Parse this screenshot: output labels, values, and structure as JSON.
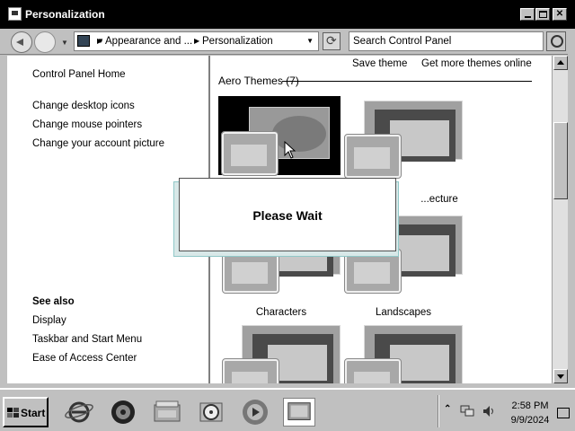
{
  "window": {
    "title": "Personalization"
  },
  "address": {
    "crumbs": [
      "Appearance and ...",
      "Personalization"
    ],
    "search_placeholder": "Search Control Panel"
  },
  "left_pane": {
    "links": [
      "Control Panel Home",
      "Change desktop icons",
      "Change mouse pointers",
      "Change your account picture"
    ],
    "see_also_heading": "See also",
    "see_also": [
      "Display",
      "Taskbar and Start Menu",
      "Ease of Access Center"
    ]
  },
  "right_pane": {
    "actions": [
      "Save theme",
      "Get more themes online"
    ],
    "group_title": "Aero Themes (7)",
    "themes": [
      "",
      "...ecture",
      "Characters",
      "Landscapes",
      "",
      ""
    ]
  },
  "dialog": {
    "message": "Please Wait"
  },
  "taskbar": {
    "start_label": "Start",
    "icons": [
      "internet-explorer-icon",
      "media-player-icon",
      "scanner-icon",
      "disc-burner-icon",
      "media-center-icon",
      "personalization-icon"
    ],
    "clock_time": "2:58 PM",
    "clock_date": "9/9/2024"
  }
}
